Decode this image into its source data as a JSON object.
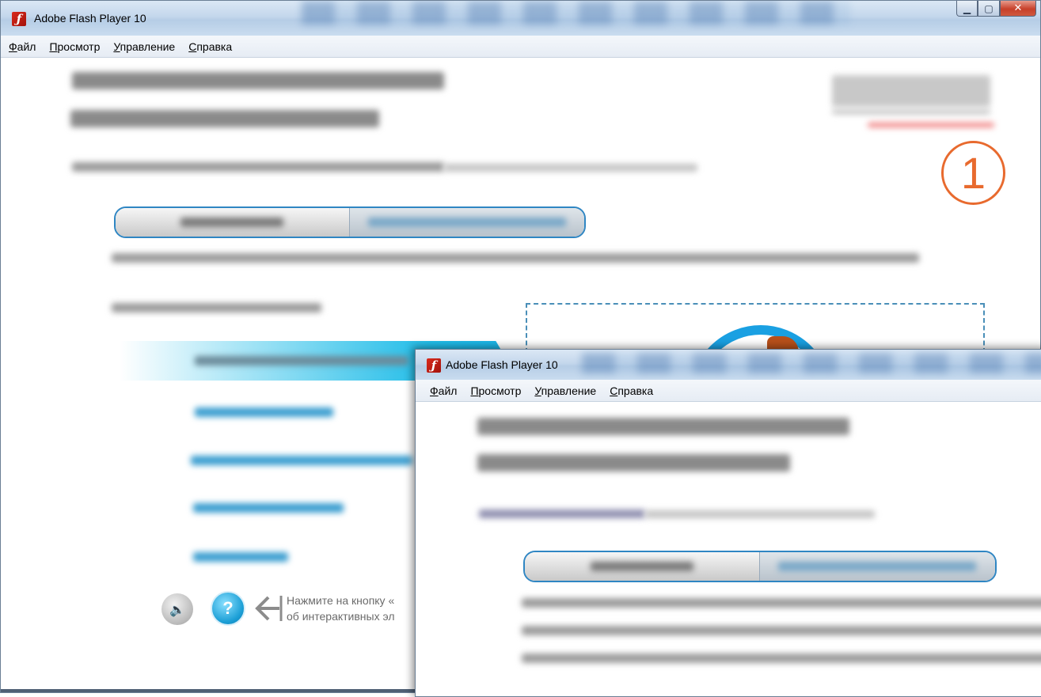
{
  "window_main": {
    "title": "Adobe Flash Player 10",
    "menu": [
      {
        "accel": "Ф",
        "rest": "айл"
      },
      {
        "accel": "П",
        "rest": "росмотр"
      },
      {
        "accel": "У",
        "rest": "правление"
      },
      {
        "accel": "С",
        "rest": "правка"
      }
    ],
    "badge_number": "1",
    "hint_line1": "Нажмите на кнопку «",
    "hint_line2": "об интерактивных эл"
  },
  "window_front": {
    "title": "Adobe Flash Player 10",
    "menu": [
      {
        "accel": "Ф",
        "rest": "айл"
      },
      {
        "accel": "П",
        "rest": "росмотр"
      },
      {
        "accel": "У",
        "rest": "правление"
      },
      {
        "accel": "С",
        "rest": "правка"
      }
    ]
  },
  "icons": {
    "app": "flash-icon",
    "speaker": "speaker-icon",
    "help": "question-icon",
    "arrow": "arrow-left-icon"
  },
  "colors": {
    "tab_border": "#2f86c3",
    "accent_orange": "#e86a2e",
    "highlight_blue": "#1ab3e6"
  }
}
